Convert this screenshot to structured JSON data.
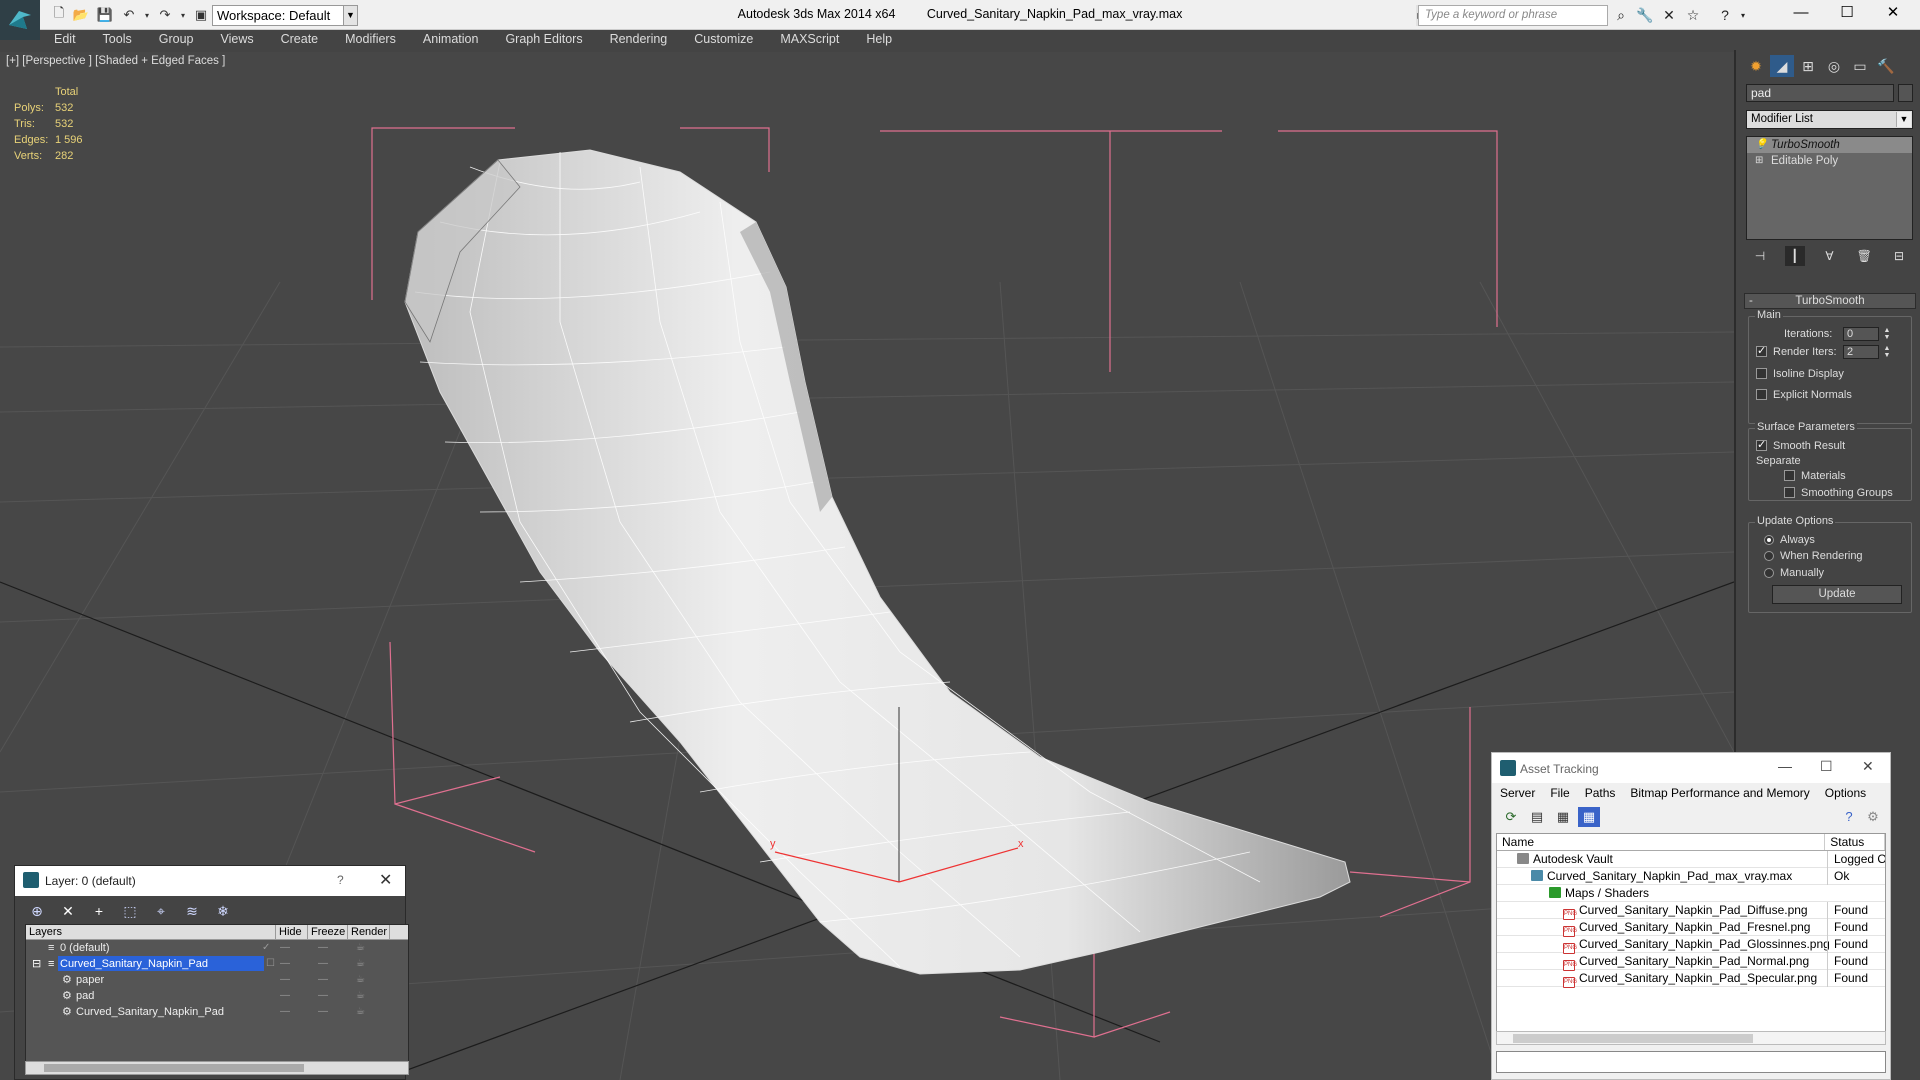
{
  "app": {
    "title": "Autodesk 3ds Max  2014 x64",
    "file": "Curved_Sanitary_Napkin_Pad_max_vray.max",
    "workspace": "Workspace: Default",
    "search_placeholder": "Type a keyword or phrase"
  },
  "menu": [
    "Edit",
    "Tools",
    "Group",
    "Views",
    "Create",
    "Modifiers",
    "Animation",
    "Graph Editors",
    "Rendering",
    "Customize",
    "MAXScript",
    "Help"
  ],
  "viewport": {
    "label": "[+] [Perspective ] [Shaded + Edged Faces ]",
    "stats": {
      "header": "Total",
      "rows": [
        {
          "label": "Polys:",
          "value": "532"
        },
        {
          "label": "Tris:",
          "value": "532"
        },
        {
          "label": "Edges:",
          "value": "1 596"
        },
        {
          "label": "Verts:",
          "value": "282"
        }
      ]
    },
    "axes": {
      "x": "x",
      "y": "y"
    }
  },
  "command_panel": {
    "object_name": "pad",
    "modifier_list": "Modifier List",
    "stack": [
      "TurboSmooth",
      "Editable Poly"
    ],
    "turbosmooth": {
      "header": "TurboSmooth",
      "main_label": "Main",
      "iterations_label": "Iterations:",
      "iterations_value": "0",
      "render_iters_label": "Render Iters:",
      "render_iters_value": "2",
      "isoline": "Isoline Display",
      "explicit_normals": "Explicit Normals",
      "surface_params": "Surface Parameters",
      "smooth_result": "Smooth Result",
      "separate": "Separate",
      "materials": "Materials",
      "smoothing_groups": "Smoothing Groups",
      "update_options": "Update Options",
      "always": "Always",
      "when_rendering": "When Rendering",
      "manually": "Manually",
      "update_button": "Update"
    }
  },
  "layer_dialog": {
    "title": "Layer: 0 (default)",
    "help": "?",
    "columns": [
      "Layers",
      "Hide",
      "Freeze",
      "Render"
    ],
    "rows": [
      {
        "name": "0 (default)",
        "indent": 0
      },
      {
        "name": "Curved_Sanitary_Napkin_Pad",
        "indent": 0,
        "selected": true
      },
      {
        "name": "paper",
        "indent": 1
      },
      {
        "name": "pad",
        "indent": 1
      },
      {
        "name": "Curved_Sanitary_Napkin_Pad",
        "indent": 1
      }
    ]
  },
  "asset_tracking": {
    "title": "Asset Tracking",
    "menu": [
      "Server",
      "File",
      "Paths",
      "Bitmap Performance and Memory",
      "Options"
    ],
    "columns": [
      "Name",
      "Status"
    ],
    "rows": [
      {
        "name": "Autodesk Vault",
        "status": "Logged Ou",
        "indent": 0
      },
      {
        "name": "Curved_Sanitary_Napkin_Pad_max_vray.max",
        "status": "Ok",
        "indent": 1
      },
      {
        "name": "Maps / Shaders",
        "status": "",
        "indent": 2
      },
      {
        "name": "Curved_Sanitary_Napkin_Pad_Diffuse.png",
        "status": "Found",
        "indent": 3
      },
      {
        "name": "Curved_Sanitary_Napkin_Pad_Fresnel.png",
        "status": "Found",
        "indent": 3
      },
      {
        "name": "Curved_Sanitary_Napkin_Pad_Glossinnes.png",
        "status": "Found",
        "indent": 3
      },
      {
        "name": "Curved_Sanitary_Napkin_Pad_Normal.png",
        "status": "Found",
        "indent": 3
      },
      {
        "name": "Curved_Sanitary_Napkin_Pad_Specular.png",
        "status": "Found",
        "indent": 3
      }
    ]
  },
  "colors": {
    "stats": "#e8d278",
    "selection": "#2a62d9",
    "bbox": "#e07090",
    "viewport_bg": "#474747"
  }
}
